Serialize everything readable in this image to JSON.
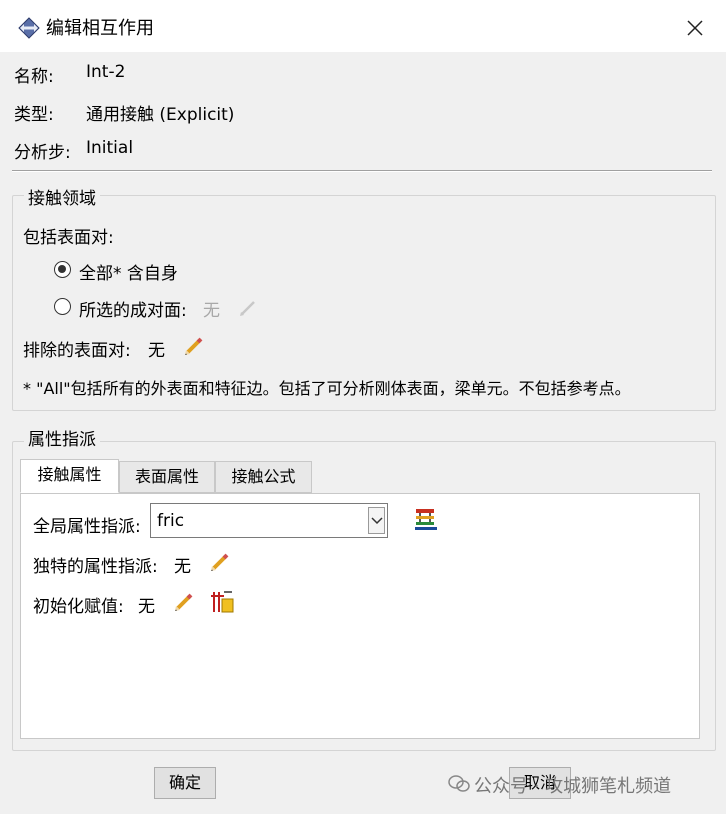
{
  "window": {
    "title": "编辑相互作用"
  },
  "fields": {
    "name_label": "名称:",
    "name_value": "Int-2",
    "type_label": "类型:",
    "type_value": "通用接触 (Explicit)",
    "step_label": "分析步:",
    "step_value": "Initial"
  },
  "contact_domain": {
    "legend": "接触领域",
    "include_label": "包括表面对:",
    "option_all": "全部* 含自身",
    "option_selected": "所选的成对面:",
    "option_selected_value": "无",
    "exclude_label": "排除的表面对:",
    "exclude_value": "无",
    "note": "* \"All\"包括所有的外表面和特征边。包括了可分析刚体表面，梁单元。不包括参考点。",
    "selected_option": "all"
  },
  "property_assignment": {
    "legend": "属性指派",
    "tabs": [
      "接触属性",
      "表面属性",
      "接触公式"
    ],
    "active_tab": 0,
    "global_label": "全局属性指派:",
    "global_value": "fric",
    "unique_label": "独特的属性指派:",
    "unique_value": "无",
    "init_label": "初始化赋值:",
    "init_value": "无"
  },
  "buttons": {
    "ok": "确定",
    "cancel": "取消"
  },
  "watermark": "公众号 · 攻城狮笔札频道",
  "colors": {
    "accent": "#2255aa",
    "disabled": "#a8a8a8"
  }
}
